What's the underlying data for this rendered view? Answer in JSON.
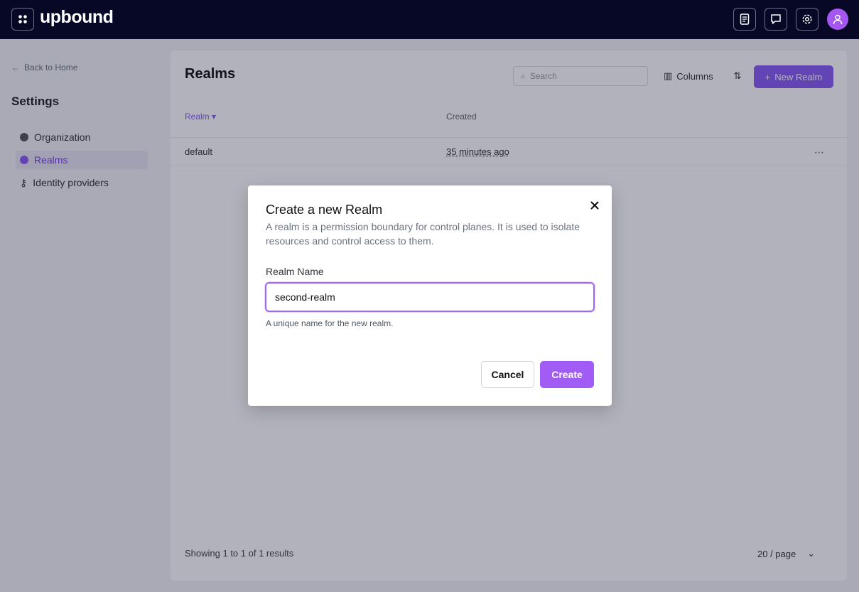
{
  "header": {
    "logo_text": "upbound",
    "icons": [
      "grid-menu-icon",
      "docs-icon",
      "chat-icon",
      "settings-icon",
      "user-icon"
    ]
  },
  "sidebar": {
    "back_label": "Back to Home",
    "title": "Settings",
    "items": [
      {
        "label": "Organization",
        "icon": "organization-icon"
      },
      {
        "label": "Realms",
        "icon": "realm-icon",
        "active": true
      },
      {
        "label": "Identity providers",
        "icon": "key-icon"
      }
    ]
  },
  "main": {
    "title": "Realms",
    "search_placeholder": "Search",
    "columns_label": "Columns",
    "new_button_label": "New Realm",
    "table": {
      "headers": [
        "Realm",
        "Created"
      ],
      "rows": [
        {
          "realm": "default",
          "created": "35 minutes ago"
        }
      ]
    },
    "footer": {
      "results_text": "Showing 1 to 1 of 1 results",
      "page_size": "20 / page"
    }
  },
  "modal": {
    "title": "Create a new Realm",
    "description": "A realm is a permission boundary for control planes. It is used to isolate resources and control access to them.",
    "field_label": "Realm Name",
    "field_value": "second-realm",
    "help_text": "A unique name for the new realm.",
    "cancel_label": "Cancel",
    "create_label": "Create"
  },
  "colors": {
    "accent": "#8b5cf6",
    "topbar": "#060826",
    "create_button": "#a15cf5"
  }
}
